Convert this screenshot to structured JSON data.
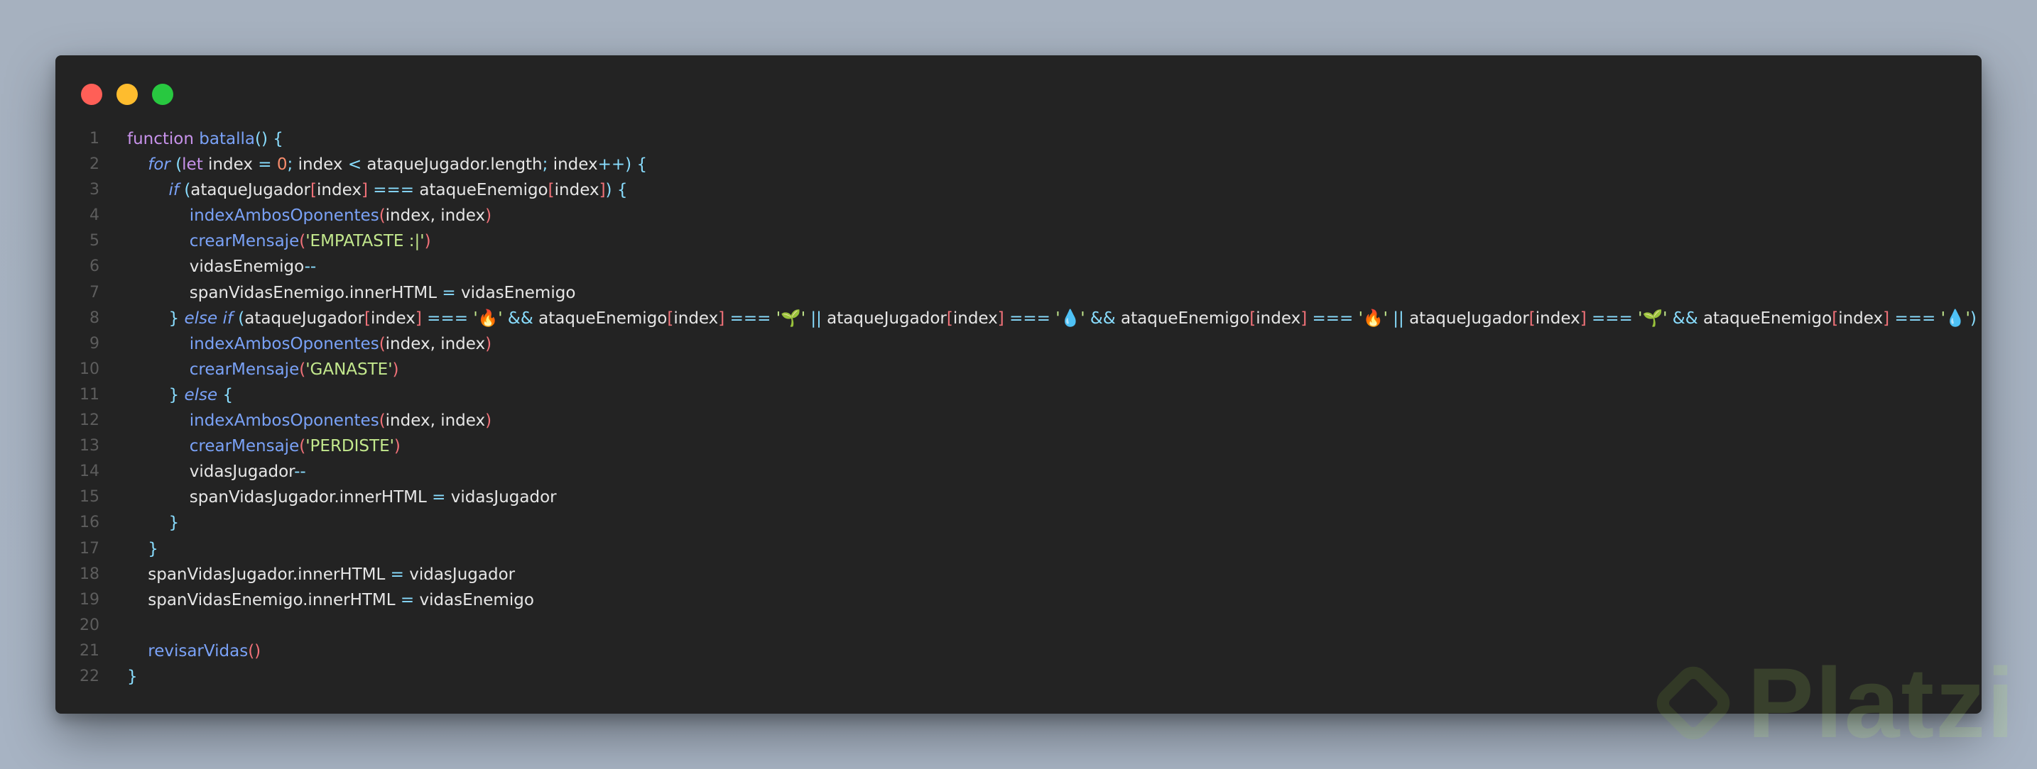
{
  "window": {
    "controls": [
      "close",
      "minimize",
      "maximize"
    ]
  },
  "code": {
    "lines": [
      {
        "num": "1",
        "tokens": [
          [
            "kw",
            "function"
          ],
          [
            "pl",
            " "
          ],
          [
            "fn",
            "batalla"
          ],
          [
            "op",
            "() {"
          ]
        ]
      },
      {
        "num": "2",
        "tokens": [
          [
            "pl",
            "    "
          ],
          [
            "kwi",
            "for"
          ],
          [
            "pl",
            " "
          ],
          [
            "op",
            "("
          ],
          [
            "kw",
            "let"
          ],
          [
            "pl",
            " index "
          ],
          [
            "op",
            "="
          ],
          [
            "pl",
            " "
          ],
          [
            "num",
            "0"
          ],
          [
            "op",
            ";"
          ],
          [
            "pl",
            " index "
          ],
          [
            "op",
            "<"
          ],
          [
            "pl",
            " ataqueJugador.length"
          ],
          [
            "op",
            ";"
          ],
          [
            "pl",
            " index"
          ],
          [
            "op",
            "++) {"
          ]
        ]
      },
      {
        "num": "3",
        "tokens": [
          [
            "pl",
            "        "
          ],
          [
            "kwi",
            "if"
          ],
          [
            "pl",
            " "
          ],
          [
            "op",
            "("
          ],
          [
            "pl",
            "ataqueJugador"
          ],
          [
            "br",
            "["
          ],
          [
            "pl",
            "index"
          ],
          [
            "br",
            "]"
          ],
          [
            "pl",
            " "
          ],
          [
            "op",
            "==="
          ],
          [
            "pl",
            " ataqueEnemigo"
          ],
          [
            "br",
            "["
          ],
          [
            "pl",
            "index"
          ],
          [
            "br",
            "]"
          ],
          [
            "op",
            ") {"
          ]
        ]
      },
      {
        "num": "4",
        "tokens": [
          [
            "pl",
            "            "
          ],
          [
            "fn",
            "indexAmbosOponentes"
          ],
          [
            "br",
            "("
          ],
          [
            "pl",
            "index, index"
          ],
          [
            "br",
            ")"
          ]
        ]
      },
      {
        "num": "5",
        "tokens": [
          [
            "pl",
            "            "
          ],
          [
            "fn",
            "crearMensaje"
          ],
          [
            "br",
            "("
          ],
          [
            "str",
            "'EMPATASTE :|'"
          ],
          [
            "br",
            ")"
          ]
        ]
      },
      {
        "num": "6",
        "tokens": [
          [
            "pl",
            "            vidasEnemigo"
          ],
          [
            "op",
            "--"
          ]
        ]
      },
      {
        "num": "7",
        "tokens": [
          [
            "pl",
            "            spanVidasEnemigo.innerHTML "
          ],
          [
            "op",
            "="
          ],
          [
            "pl",
            " vidasEnemigo"
          ]
        ]
      },
      {
        "num": "8",
        "tokens": [
          [
            "pl",
            "        "
          ],
          [
            "op",
            "} "
          ],
          [
            "kwi",
            "else if"
          ],
          [
            "pl",
            " "
          ],
          [
            "op",
            "("
          ],
          [
            "pl",
            "ataqueJugador"
          ],
          [
            "br",
            "["
          ],
          [
            "pl",
            "index"
          ],
          [
            "br",
            "]"
          ],
          [
            "pl",
            " "
          ],
          [
            "op",
            "==="
          ],
          [
            "pl",
            " "
          ],
          [
            "str",
            "'🔥'"
          ],
          [
            "pl",
            " "
          ],
          [
            "op",
            "&&"
          ],
          [
            "pl",
            " ataqueEnemigo"
          ],
          [
            "br",
            "["
          ],
          [
            "pl",
            "index"
          ],
          [
            "br",
            "]"
          ],
          [
            "pl",
            " "
          ],
          [
            "op",
            "==="
          ],
          [
            "pl",
            " "
          ],
          [
            "str",
            "'🌱'"
          ],
          [
            "pl",
            " "
          ],
          [
            "op",
            "||"
          ],
          [
            "pl",
            " ataqueJugador"
          ],
          [
            "br",
            "["
          ],
          [
            "pl",
            "index"
          ],
          [
            "br",
            "]"
          ],
          [
            "pl",
            " "
          ],
          [
            "op",
            "==="
          ],
          [
            "pl",
            " "
          ],
          [
            "str",
            "'💧'"
          ],
          [
            "pl",
            " "
          ],
          [
            "op",
            "&&"
          ],
          [
            "pl",
            " ataqueEnemigo"
          ],
          [
            "br",
            "["
          ],
          [
            "pl",
            "index"
          ],
          [
            "br",
            "]"
          ],
          [
            "pl",
            " "
          ],
          [
            "op",
            "==="
          ],
          [
            "pl",
            " "
          ],
          [
            "str",
            "'🔥'"
          ],
          [
            "pl",
            " "
          ],
          [
            "op",
            "||"
          ],
          [
            "pl",
            " ataqueJugador"
          ],
          [
            "br",
            "["
          ],
          [
            "pl",
            "index"
          ],
          [
            "br",
            "]"
          ],
          [
            "pl",
            " "
          ],
          [
            "op",
            "==="
          ],
          [
            "pl",
            " "
          ],
          [
            "str",
            "'🌱'"
          ],
          [
            "pl",
            " "
          ],
          [
            "op",
            "&&"
          ],
          [
            "pl",
            " ataqueEnemigo"
          ],
          [
            "br",
            "["
          ],
          [
            "pl",
            "index"
          ],
          [
            "br",
            "]"
          ],
          [
            "pl",
            " "
          ],
          [
            "op",
            "==="
          ],
          [
            "pl",
            " "
          ],
          [
            "str",
            "'💧'"
          ],
          [
            "op",
            ") {"
          ]
        ]
      },
      {
        "num": "9",
        "tokens": [
          [
            "pl",
            "            "
          ],
          [
            "fn",
            "indexAmbosOponentes"
          ],
          [
            "br",
            "("
          ],
          [
            "pl",
            "index, index"
          ],
          [
            "br",
            ")"
          ]
        ]
      },
      {
        "num": "10",
        "tokens": [
          [
            "pl",
            "            "
          ],
          [
            "fn",
            "crearMensaje"
          ],
          [
            "br",
            "("
          ],
          [
            "str",
            "'GANASTE'"
          ],
          [
            "br",
            ")"
          ]
        ]
      },
      {
        "num": "11",
        "tokens": [
          [
            "pl",
            "        "
          ],
          [
            "op",
            "} "
          ],
          [
            "kwi",
            "else"
          ],
          [
            "op",
            " {"
          ]
        ]
      },
      {
        "num": "12",
        "tokens": [
          [
            "pl",
            "            "
          ],
          [
            "fn",
            "indexAmbosOponentes"
          ],
          [
            "br",
            "("
          ],
          [
            "pl",
            "index, index"
          ],
          [
            "br",
            ")"
          ]
        ]
      },
      {
        "num": "13",
        "tokens": [
          [
            "pl",
            "            "
          ],
          [
            "fn",
            "crearMensaje"
          ],
          [
            "br",
            "("
          ],
          [
            "str",
            "'PERDISTE'"
          ],
          [
            "br",
            ")"
          ]
        ]
      },
      {
        "num": "14",
        "tokens": [
          [
            "pl",
            "            vidasJugador"
          ],
          [
            "op",
            "--"
          ]
        ]
      },
      {
        "num": "15",
        "tokens": [
          [
            "pl",
            "            spanVidasJugador.innerHTML "
          ],
          [
            "op",
            "="
          ],
          [
            "pl",
            " vidasJugador"
          ]
        ]
      },
      {
        "num": "16",
        "tokens": [
          [
            "pl",
            "        "
          ],
          [
            "op",
            "}"
          ]
        ]
      },
      {
        "num": "17",
        "tokens": [
          [
            "pl",
            "    "
          ],
          [
            "op",
            "}"
          ]
        ]
      },
      {
        "num": "18",
        "tokens": [
          [
            "pl",
            "    spanVidasJugador.innerHTML "
          ],
          [
            "op",
            "="
          ],
          [
            "pl",
            " vidasJugador"
          ]
        ]
      },
      {
        "num": "19",
        "tokens": [
          [
            "pl",
            "    spanVidasEnemigo.innerHTML "
          ],
          [
            "op",
            "="
          ],
          [
            "pl",
            " vidasEnemigo"
          ]
        ]
      },
      {
        "num": "20",
        "tokens": []
      },
      {
        "num": "21",
        "tokens": [
          [
            "pl",
            "    "
          ],
          [
            "fn",
            "revisarVidas"
          ],
          [
            "br",
            "()"
          ]
        ]
      },
      {
        "num": "22",
        "tokens": [
          [
            "op",
            "}"
          ]
        ]
      }
    ]
  },
  "watermark": {
    "text": "Platzi",
    "color": "#98CA3F"
  }
}
